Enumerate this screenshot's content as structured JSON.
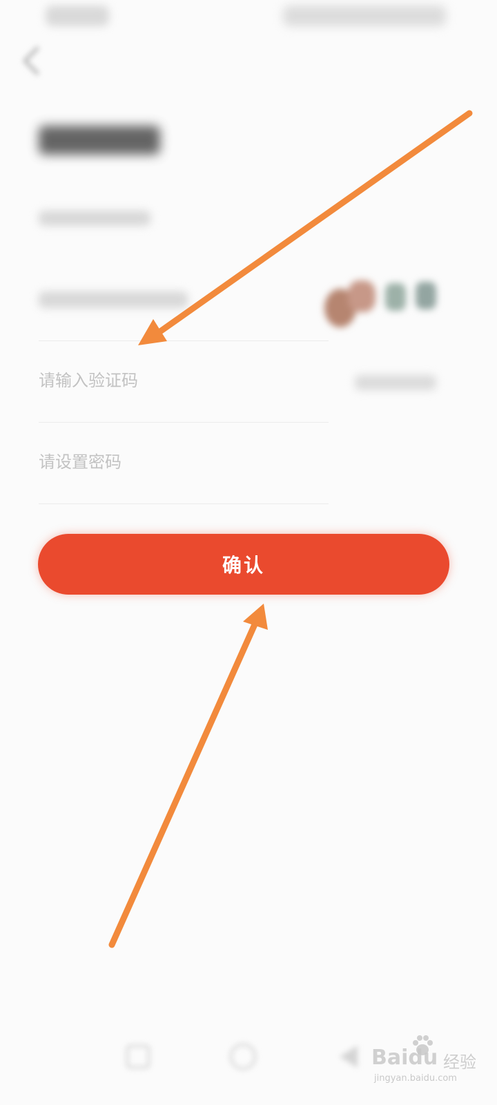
{
  "form": {
    "code_placeholder": "请输入验证码",
    "password_placeholder": "请设置密码"
  },
  "confirm_button": {
    "label": "确认",
    "color": "#ea4a2e"
  },
  "annotation": {
    "arrow_color": "#f28a3c"
  },
  "icons": {
    "back": "chevron-left-icon",
    "nav_recent": "square-icon",
    "nav_home": "circle-icon",
    "nav_back": "triangle-icon"
  },
  "watermark": {
    "logo": "Baidu",
    "cn": "经验",
    "url": "jingyan.baidu.com"
  }
}
